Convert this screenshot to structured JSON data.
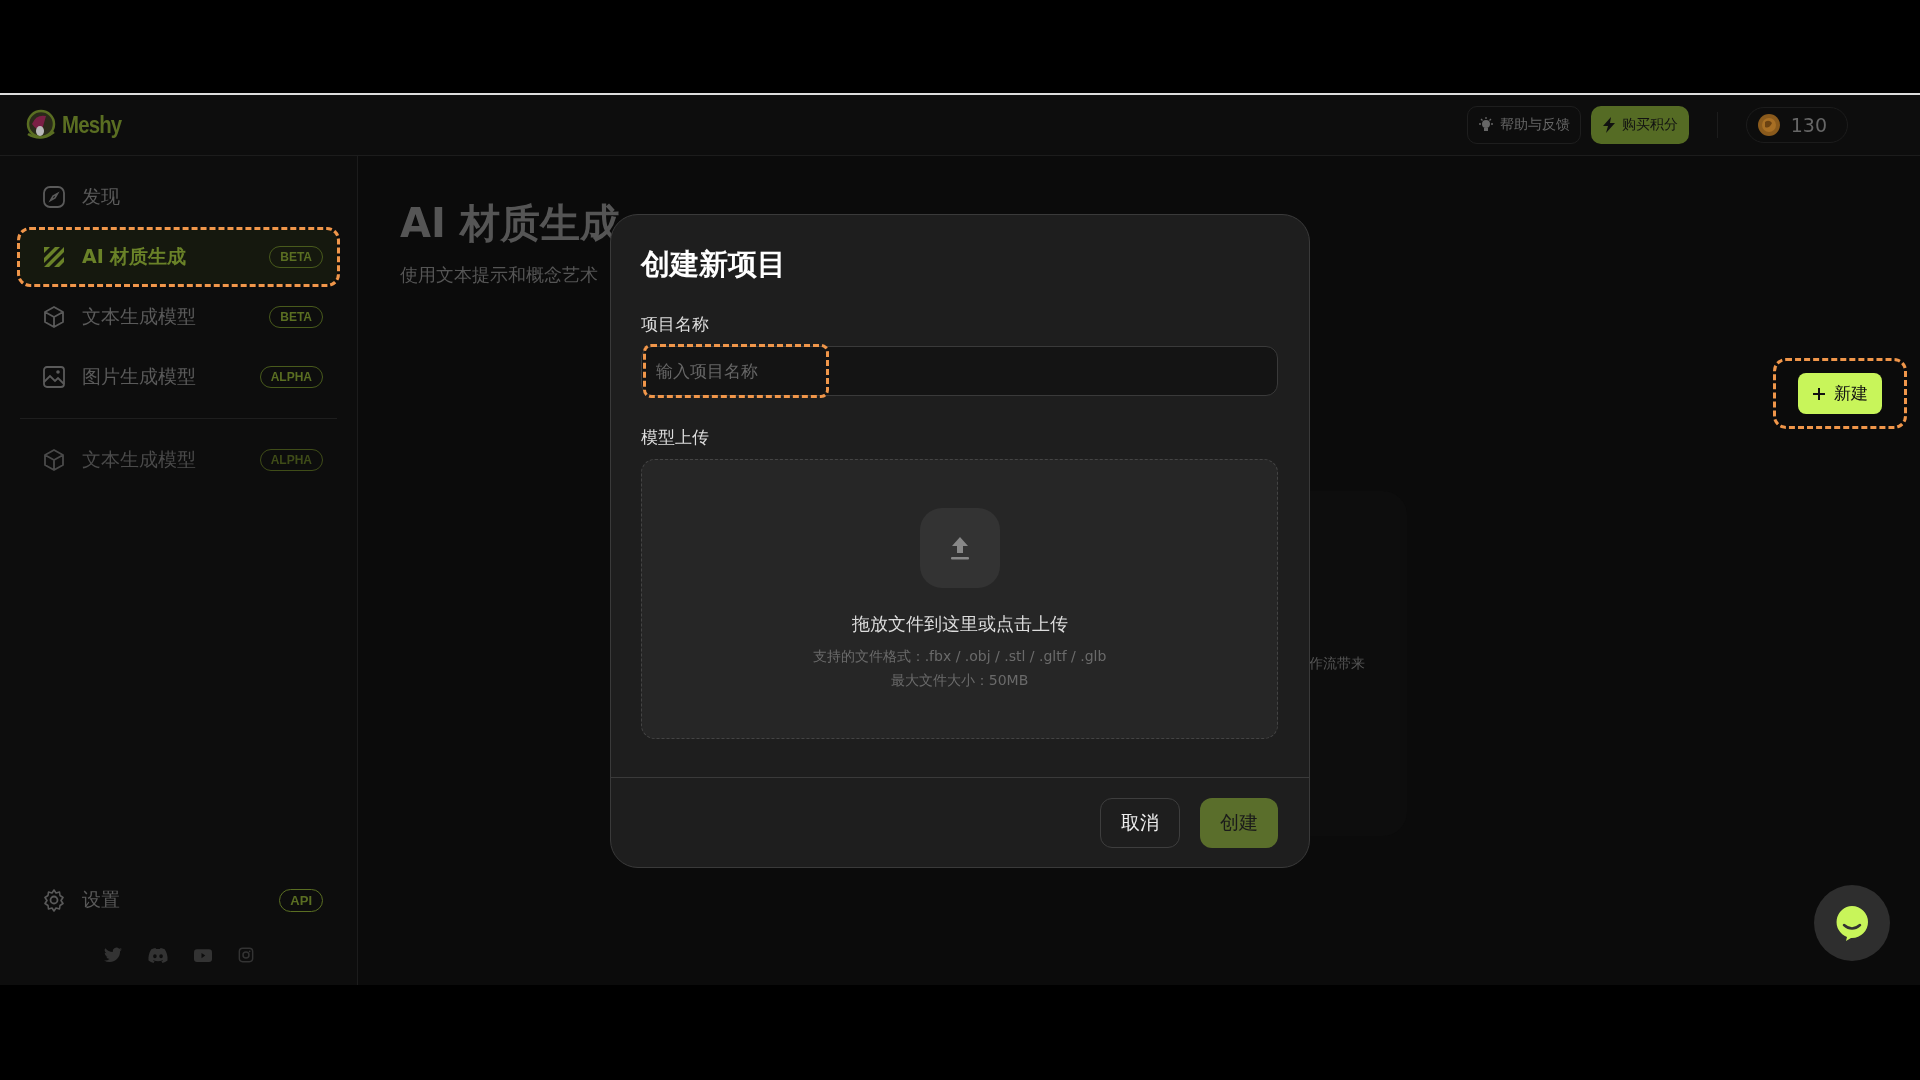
{
  "header": {
    "logo": "Meshy",
    "help_button": "帮助与反馈",
    "buy_button": "购买积分",
    "credits": "130"
  },
  "sidebar": {
    "items": [
      {
        "label": "发现",
        "selected": false,
        "highlighted": false,
        "dimmed": false
      },
      {
        "label": "AI 材质生成",
        "badge": "BETA",
        "selected": true,
        "highlighted": true,
        "dimmed": false
      },
      {
        "label": "文本生成模型",
        "badge": "BETA",
        "selected": false,
        "highlighted": false,
        "dimmed": false
      },
      {
        "label": "图片生成模型",
        "badge": "ALPHA",
        "selected": false,
        "highlighted": false,
        "dimmed": false
      },
      {
        "label": "文本生成模型",
        "badge": "ALPHA",
        "selected": false,
        "highlighted": false,
        "dimmed": true
      }
    ],
    "settings": {
      "label": "设置",
      "badge": "API"
    }
  },
  "page": {
    "title": "AI 材质生成",
    "subtitle": "使用文本提示和概念艺术",
    "new_button": {
      "label": "新建",
      "highlighted": true
    },
    "card_text": "作流带来"
  },
  "dialog": {
    "title": "创建新项目",
    "name_label": "项目名称",
    "name_field": {
      "placeholder": "输入项目名称",
      "highlighted": true
    },
    "upload_label": "模型上传",
    "drop_title": "拖放文件到这里或点击上传",
    "formats": "支持的文件格式：.fbx / .obj / .stl / .gltf / .glb",
    "max_size": "最大文件大小：50MB",
    "cancel": "取消",
    "create": "创建"
  }
}
